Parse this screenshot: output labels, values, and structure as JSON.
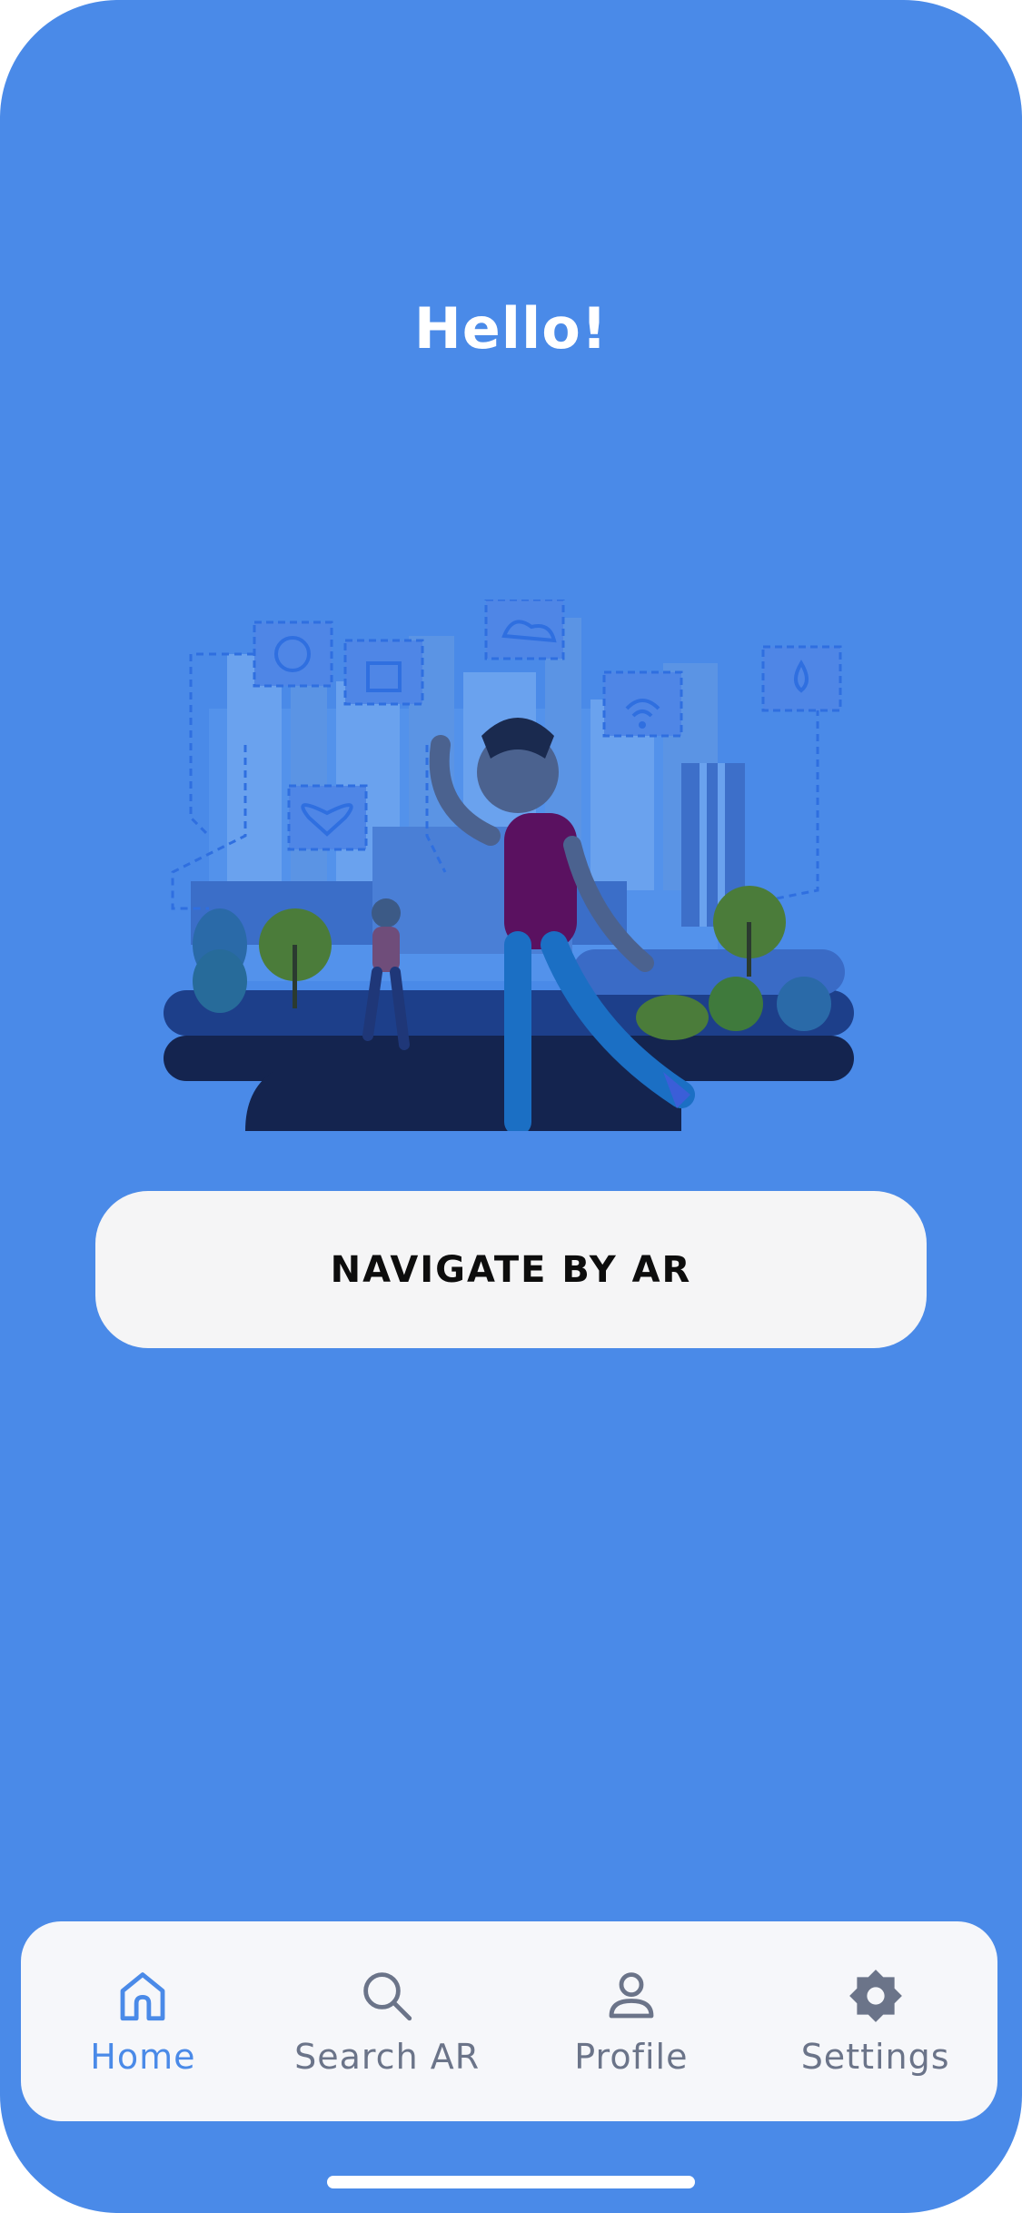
{
  "header": {
    "greeting": "Hello!"
  },
  "main": {
    "navigate_button_label": "NAVIGATE BY AR"
  },
  "tabbar": {
    "items": [
      {
        "label": "Home",
        "icon": "home-icon",
        "active": true
      },
      {
        "label": "Search AR",
        "icon": "search-icon",
        "active": false
      },
      {
        "label": "Profile",
        "icon": "user-icon",
        "active": false
      },
      {
        "label": "Settings",
        "icon": "gear-icon",
        "active": false
      }
    ]
  },
  "colors": {
    "background": "#4a8ae8",
    "button_bg": "#f5f5f6",
    "tabbar_bg": "#f6f7fa",
    "active_tab": "#4a8ae8",
    "inactive_tab": "#6b7489"
  }
}
